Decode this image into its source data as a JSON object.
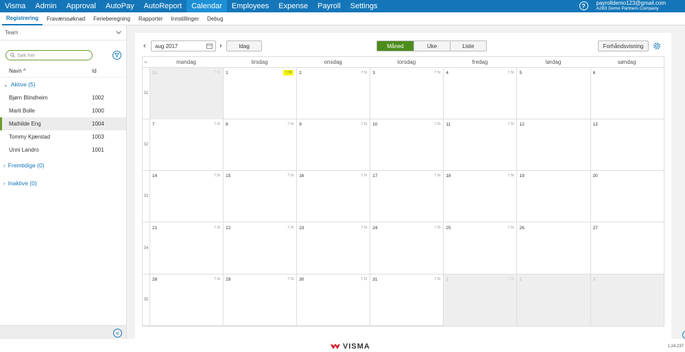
{
  "topnav": {
    "items": [
      "Visma",
      "Admin",
      "Approval",
      "AutoPay",
      "AutoReport",
      "Calendar",
      "Employees",
      "Expense",
      "Payroll",
      "Settings"
    ],
    "active_index": 5,
    "help_label": "?",
    "user_email": "payrolldemo123@gmail.com",
    "user_company": "A2B3 Demo Partners Company"
  },
  "subnav": {
    "items": [
      "Registrering",
      "Fraværssøknad",
      "Ferieberegning",
      "Rapporter",
      "Innstillinger",
      "Debug"
    ],
    "active_index": 0
  },
  "sidebar": {
    "team_label": "Team",
    "search_placeholder": "Søk her",
    "col_name": "Navn ^",
    "col_id": "Id",
    "active_group": "Aktive (5)",
    "employees": [
      {
        "name": "Bjørn Blindheim",
        "id": "1002"
      },
      {
        "name": "Marit Bolle",
        "id": "1000"
      },
      {
        "name": "Mathilde Eng",
        "id": "1004"
      },
      {
        "name": "Tommy Kjærstad",
        "id": "1003"
      },
      {
        "name": "Unni Landro",
        "id": "1001"
      }
    ],
    "selected_index": 2,
    "future_group": "Fremtidige (0)",
    "inactive_group": "Inaktive (0)",
    "collapse_label": "«"
  },
  "toolbar": {
    "prev": "‹",
    "next": "›",
    "month_value": "aug 2017",
    "today": "Idag",
    "views": [
      "Måned",
      "Uke",
      "Liste"
    ],
    "active_view": 0,
    "preview": "Forhåndsvisning"
  },
  "calendar": {
    "week_header": "Nr.",
    "day_names": [
      "mandag",
      "tirsdag",
      "onsdag",
      "torsdag",
      "fredag",
      "lørdag",
      "søndag"
    ],
    "weeks": [
      {
        "num": "31",
        "days": [
          {
            "d": "31",
            "h": "7.5t",
            "muted": true
          },
          {
            "d": "1",
            "h": "7.5t",
            "hl": true
          },
          {
            "d": "2",
            "h": "7.5t"
          },
          {
            "d": "3",
            "h": "7.5t"
          },
          {
            "d": "4",
            "h": "7.5t"
          },
          {
            "d": "5",
            "h": ""
          },
          {
            "d": "6",
            "h": ""
          }
        ]
      },
      {
        "num": "32",
        "days": [
          {
            "d": "7",
            "h": "7.5t"
          },
          {
            "d": "8",
            "h": "7.5t"
          },
          {
            "d": "9",
            "h": "7.5t"
          },
          {
            "d": "10",
            "h": "7.5t"
          },
          {
            "d": "11",
            "h": "7.5t"
          },
          {
            "d": "12",
            "h": ""
          },
          {
            "d": "13",
            "h": ""
          }
        ]
      },
      {
        "num": "33",
        "days": [
          {
            "d": "14",
            "h": "7.5t"
          },
          {
            "d": "15",
            "h": "7.5t"
          },
          {
            "d": "16",
            "h": "7.5t"
          },
          {
            "d": "17",
            "h": "7.5t"
          },
          {
            "d": "18",
            "h": "7.5t"
          },
          {
            "d": "19",
            "h": ""
          },
          {
            "d": "20",
            "h": ""
          }
        ]
      },
      {
        "num": "34",
        "days": [
          {
            "d": "21",
            "h": "7.5t"
          },
          {
            "d": "22",
            "h": "7.5t"
          },
          {
            "d": "23",
            "h": "7.5t"
          },
          {
            "d": "24",
            "h": "7.5t"
          },
          {
            "d": "25",
            "h": "7.5t"
          },
          {
            "d": "26",
            "h": ""
          },
          {
            "d": "27",
            "h": ""
          }
        ]
      },
      {
        "num": "35",
        "days": [
          {
            "d": "28",
            "h": "7.5t"
          },
          {
            "d": "29",
            "h": "7.5t"
          },
          {
            "d": "30",
            "h": "7.5t"
          },
          {
            "d": "31",
            "h": "7.5t"
          },
          {
            "d": "1",
            "h": "7.5t",
            "muted": true
          },
          {
            "d": "2",
            "h": "",
            "muted": true
          },
          {
            "d": "3",
            "h": "",
            "muted": true
          }
        ]
      }
    ]
  },
  "footer": {
    "logo_text": "VISMA",
    "version": "1.24.237"
  },
  "colors": {
    "nav_blue": "#1476b8",
    "active_green": "#4c8c1b",
    "highlight_yellow": "#f7f700"
  }
}
